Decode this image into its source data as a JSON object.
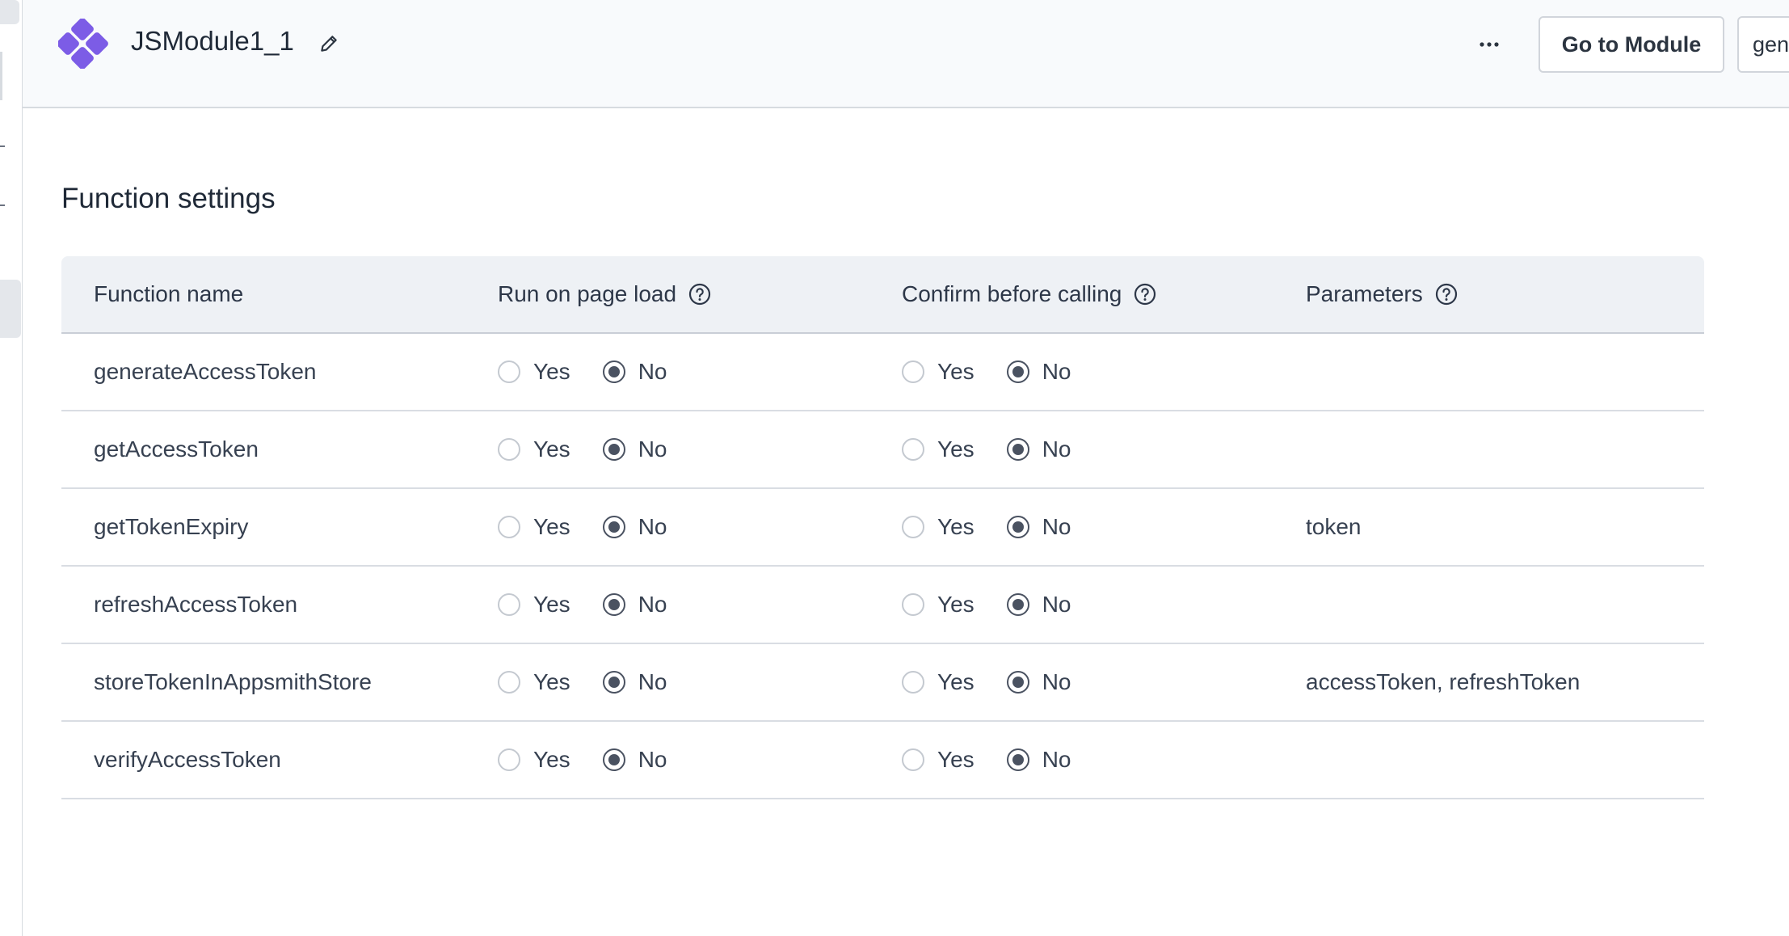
{
  "header": {
    "title": "JSModule1_1",
    "go_to_module_label": "Go to Module",
    "truncated_button_label": "gen"
  },
  "icons": {
    "logo": "appsmith-logo-icon",
    "edit": "pencil-icon",
    "more": "more-horizontal-icon",
    "help": "question-circle-icon"
  },
  "colors": {
    "logo": "#7c5ce6",
    "radio_selected": "#4a5261",
    "header_bg": "#f8fafc"
  },
  "section_title": "Function settings",
  "table": {
    "columns": [
      "Function name",
      "Run on page load",
      "Confirm before calling",
      "Parameters"
    ],
    "option_yes": "Yes",
    "option_no": "No",
    "rows": [
      {
        "name": "generateAccessToken",
        "run_on_page_load": "No",
        "confirm_before_calling": "No",
        "parameters": ""
      },
      {
        "name": "getAccessToken",
        "run_on_page_load": "No",
        "confirm_before_calling": "No",
        "parameters": ""
      },
      {
        "name": "getTokenExpiry",
        "run_on_page_load": "No",
        "confirm_before_calling": "No",
        "parameters": "token"
      },
      {
        "name": "refreshAccessToken",
        "run_on_page_load": "No",
        "confirm_before_calling": "No",
        "parameters": ""
      },
      {
        "name": "storeTokenInAppsmithStore",
        "run_on_page_load": "No",
        "confirm_before_calling": "No",
        "parameters": "accessToken, refreshToken"
      },
      {
        "name": "verifyAccessToken",
        "run_on_page_load": "No",
        "confirm_before_calling": "No",
        "parameters": ""
      }
    ]
  }
}
